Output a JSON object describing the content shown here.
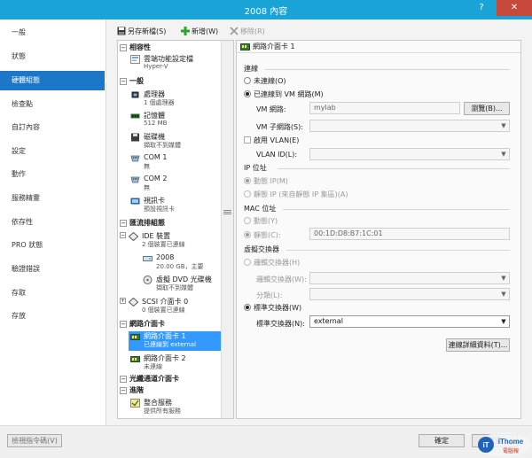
{
  "window": {
    "title": "2008 內容",
    "help_glyph": "?",
    "close_glyph": "✕"
  },
  "leftnav": {
    "items": [
      {
        "label": "一般"
      },
      {
        "label": "狀態"
      },
      {
        "label": "硬體組態"
      },
      {
        "label": "檢查點"
      },
      {
        "label": "自訂內容"
      },
      {
        "label": "設定"
      },
      {
        "label": "動作"
      },
      {
        "label": "服務精靈"
      },
      {
        "label": "依存性"
      },
      {
        "label": "PRO 狀態"
      },
      {
        "label": "驗證錯誤"
      },
      {
        "label": "存取"
      },
      {
        "label": "存放"
      }
    ],
    "active_index": 2
  },
  "toolbar": {
    "save_as": "另存新檔(S)",
    "new": "新增(W)",
    "remove": "移除(R)"
  },
  "tree": {
    "sections": {
      "compat": "相容性",
      "general": "一般",
      "bus": "匯流排組態",
      "network": "網路介面卡",
      "fc": "光纖通道介面卡",
      "advanced": "進階"
    },
    "nodes": {
      "cloud": {
        "t1": "雲端功能設定檔",
        "t2": "Hyper-V"
      },
      "cpu": {
        "t1": "處理器",
        "t2": "1 個處理器"
      },
      "mem": {
        "t1": "記憶體",
        "t2": "512 MB"
      },
      "floppy": {
        "t1": "磁碟機",
        "t2": "擷取不到媒體"
      },
      "com1": {
        "t1": "COM 1",
        "t2": "無"
      },
      "com2": {
        "t1": "COM 2",
        "t2": "無"
      },
      "video": {
        "t1": "視訊卡",
        "t2": "預設視訊卡"
      },
      "ide": {
        "t1": "IDE 裝置",
        "t2": "2 個裝置已連線"
      },
      "vhd": {
        "t1": "2008",
        "t2": "20.00 GB，主要"
      },
      "dvd": {
        "t1": "虛擬 DVD 光碟機",
        "t2": "擷取不到媒體"
      },
      "scsi": {
        "t1": "SCSI 介面卡 0",
        "t2": "0 個裝置已連線"
      },
      "nic1": {
        "t1": "網路介面卡 1",
        "t2": "已連線到 external"
      },
      "nic2": {
        "t1": "網路介面卡 2",
        "t2": "未連線"
      },
      "integration": {
        "t1": "整合服務",
        "t2": "提供所有服務"
      }
    }
  },
  "detail": {
    "header": "網路介面卡 1",
    "connection": {
      "label": "連線",
      "not_connected": "未連線(O)",
      "connected_vm": "已連線到 VM 網路(M)",
      "vm_network_label": "VM 網路:",
      "vm_network_value": "mylab",
      "browse": "瀏覽(B)...",
      "vm_subnet_label": "VM 子網路(S):",
      "enable_vlan": "啟用 VLAN(E)",
      "vlan_id_label": "VLAN ID(L):"
    },
    "ip": {
      "label": "IP 位址",
      "dynamic": "動態 IP(M)",
      "static": "靜態 IP (來自靜態 IP 集區)(A)"
    },
    "mac": {
      "label": "MAC 位址",
      "dynamic": "動態(Y)",
      "static": "靜態(C):",
      "value": "00:1D:D8:B7:1C:01"
    },
    "vswitch": {
      "label": "虛擬交換器",
      "logical": "邏輯交換器(H)",
      "logical_switch_label": "邏輯交換器(W):",
      "segment_label": "分類(L):",
      "standard": "標準交換器(W)",
      "standard_switch_label": "標準交換器(N):",
      "standard_switch_value": "external",
      "details_button": "連線詳細資料(T)..."
    }
  },
  "bottom": {
    "view_script": "檢視指令碼(V)",
    "ok": "確定",
    "cancel": "取消"
  },
  "watermark": {
    "text": "iThome",
    "sub": "電腦報"
  },
  "colors": {
    "titlebar": "#19a3d6",
    "nav_active": "#1d77c9",
    "selection": "#3399ff",
    "close": "#c7493c"
  }
}
